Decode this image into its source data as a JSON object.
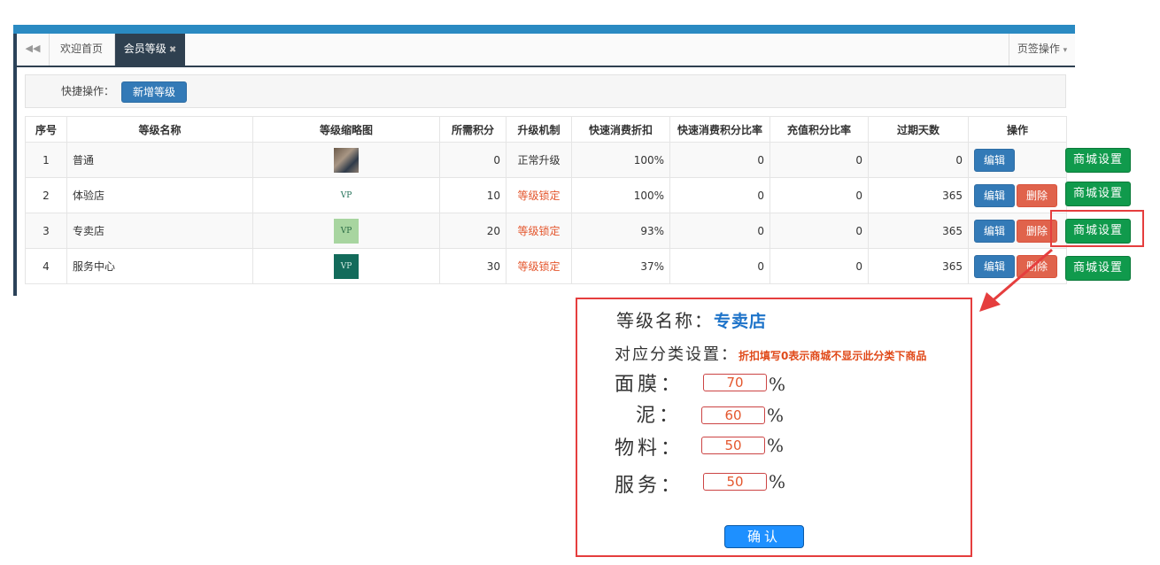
{
  "tabs": {
    "back_icon": "double-left-arrow-icon",
    "home": "欢迎首页",
    "member_level": "会员等级",
    "close_mark": "✖",
    "page_ops": "页签操作",
    "page_ops_caret": "▾"
  },
  "quick": {
    "label": "快捷操作：",
    "add_button": "新增等级"
  },
  "table": {
    "headers": [
      "序号",
      "等级名称",
      "等级缩略图",
      "所需积分",
      "升级机制",
      "快速消费折扣",
      "快速消费积分比率",
      "充值积分比率",
      "过期天数",
      "操作"
    ],
    "rows": [
      {
        "no": "1",
        "name": "普通",
        "points": "0",
        "mechanism": "正常升级",
        "discount": "100%",
        "quick_ratio": "0",
        "recharge_ratio": "0",
        "days": "0",
        "edit": "编辑",
        "delete": "",
        "thumb": "photo",
        "thumb_text": ""
      },
      {
        "no": "2",
        "name": "体验店",
        "points": "10",
        "mechanism": "等级锁定",
        "discount": "100%",
        "quick_ratio": "0",
        "recharge_ratio": "0",
        "days": "365",
        "edit": "编辑",
        "delete": "删除",
        "thumb": "vp-white",
        "thumb_text": "VP"
      },
      {
        "no": "3",
        "name": "专卖店",
        "points": "20",
        "mechanism": "等级锁定",
        "discount": "93%",
        "quick_ratio": "0",
        "recharge_ratio": "0",
        "days": "365",
        "edit": "编辑",
        "delete": "删除",
        "thumb": "vp-green",
        "thumb_text": "VP"
      },
      {
        "no": "4",
        "name": "服务中心",
        "points": "30",
        "mechanism": "等级锁定",
        "discount": "37%",
        "quick_ratio": "0",
        "recharge_ratio": "0",
        "days": "365",
        "edit": "编辑",
        "delete": "删除",
        "thumb": "vp-dark",
        "thumb_text": "VP"
      }
    ]
  },
  "mall_button_label": "商城设置",
  "dialog": {
    "name_label": "等级名称：",
    "name_value": "专卖店",
    "category_label": "对应分类设置：",
    "category_hint": "折扣填写0表示商城不显示此分类下商品",
    "fields": [
      {
        "label": "面膜：",
        "value": "70",
        "unit": "%"
      },
      {
        "label": "泥：",
        "value": "60",
        "unit": "%"
      },
      {
        "label": "物料：",
        "value": "50",
        "unit": "%"
      },
      {
        "label": "服务：",
        "value": "50",
        "unit": "%"
      }
    ],
    "confirm": "确认"
  },
  "colors": {
    "accent_blue": "#337ab7",
    "danger_red": "#e0634c",
    "mall_green": "#109a4c",
    "annotation_red": "#e53e3e",
    "dark_tab": "#2f4050"
  }
}
